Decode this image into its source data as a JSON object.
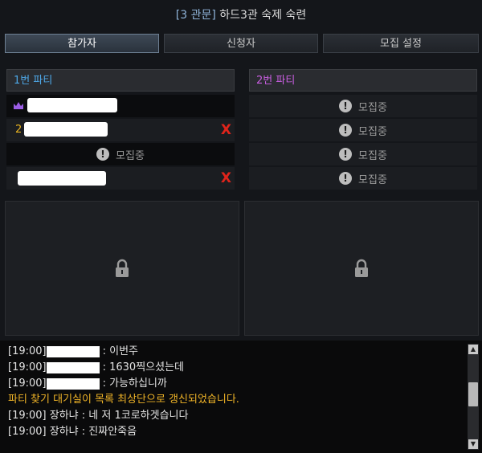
{
  "window": {
    "category": "[3 관문]",
    "title": "하드3관 숙제 숙련"
  },
  "tabs": [
    {
      "label": "참가자",
      "active": true
    },
    {
      "label": "신청자",
      "active": false
    },
    {
      "label": "모집 설정",
      "active": false
    }
  ],
  "parties": [
    {
      "name": "1번 파티",
      "color": "#4ea8e8",
      "slots": [
        {
          "type": "member",
          "leader": true,
          "kick": false
        },
        {
          "type": "member",
          "number": "2",
          "kick": true
        },
        {
          "type": "recruiting",
          "label": "모집중"
        },
        {
          "type": "member",
          "kick": true
        }
      ]
    },
    {
      "name": "2번 파티",
      "color": "#c85ee0",
      "slots": [
        {
          "type": "recruiting",
          "label": "모집중"
        },
        {
          "type": "recruiting",
          "label": "모집중"
        },
        {
          "type": "recruiting",
          "label": "모집중"
        },
        {
          "type": "recruiting",
          "label": "모집중"
        }
      ]
    }
  ],
  "kick_symbol": "X",
  "icons": {
    "recruit": "exclamation-circle-icon",
    "leader": "crown-icon",
    "locked": "lock-icon"
  },
  "chat": [
    {
      "time": "[19:00]",
      "speaker": "",
      "text": ": 이번주"
    },
    {
      "time": "[19:00]",
      "speaker": "",
      "text": ": 1630찍으셨는데"
    },
    {
      "time": "[19:00]",
      "speaker": "",
      "text": ": 가능하십니까"
    },
    {
      "system": "파티 찾기 대기실이 목록 최상단으로 갱신되었습니다."
    },
    {
      "time": "[19:00]",
      "speaker": "장하냐",
      "text": ": 네 저 1코로하겟습니다"
    },
    {
      "time": "[19:00]",
      "speaker": "장하냐",
      "text": ": 진짜안죽음"
    }
  ],
  "colors": {
    "system_message": "#f0b427",
    "kick": "#e0241b",
    "active_tab": "#3e4956"
  }
}
